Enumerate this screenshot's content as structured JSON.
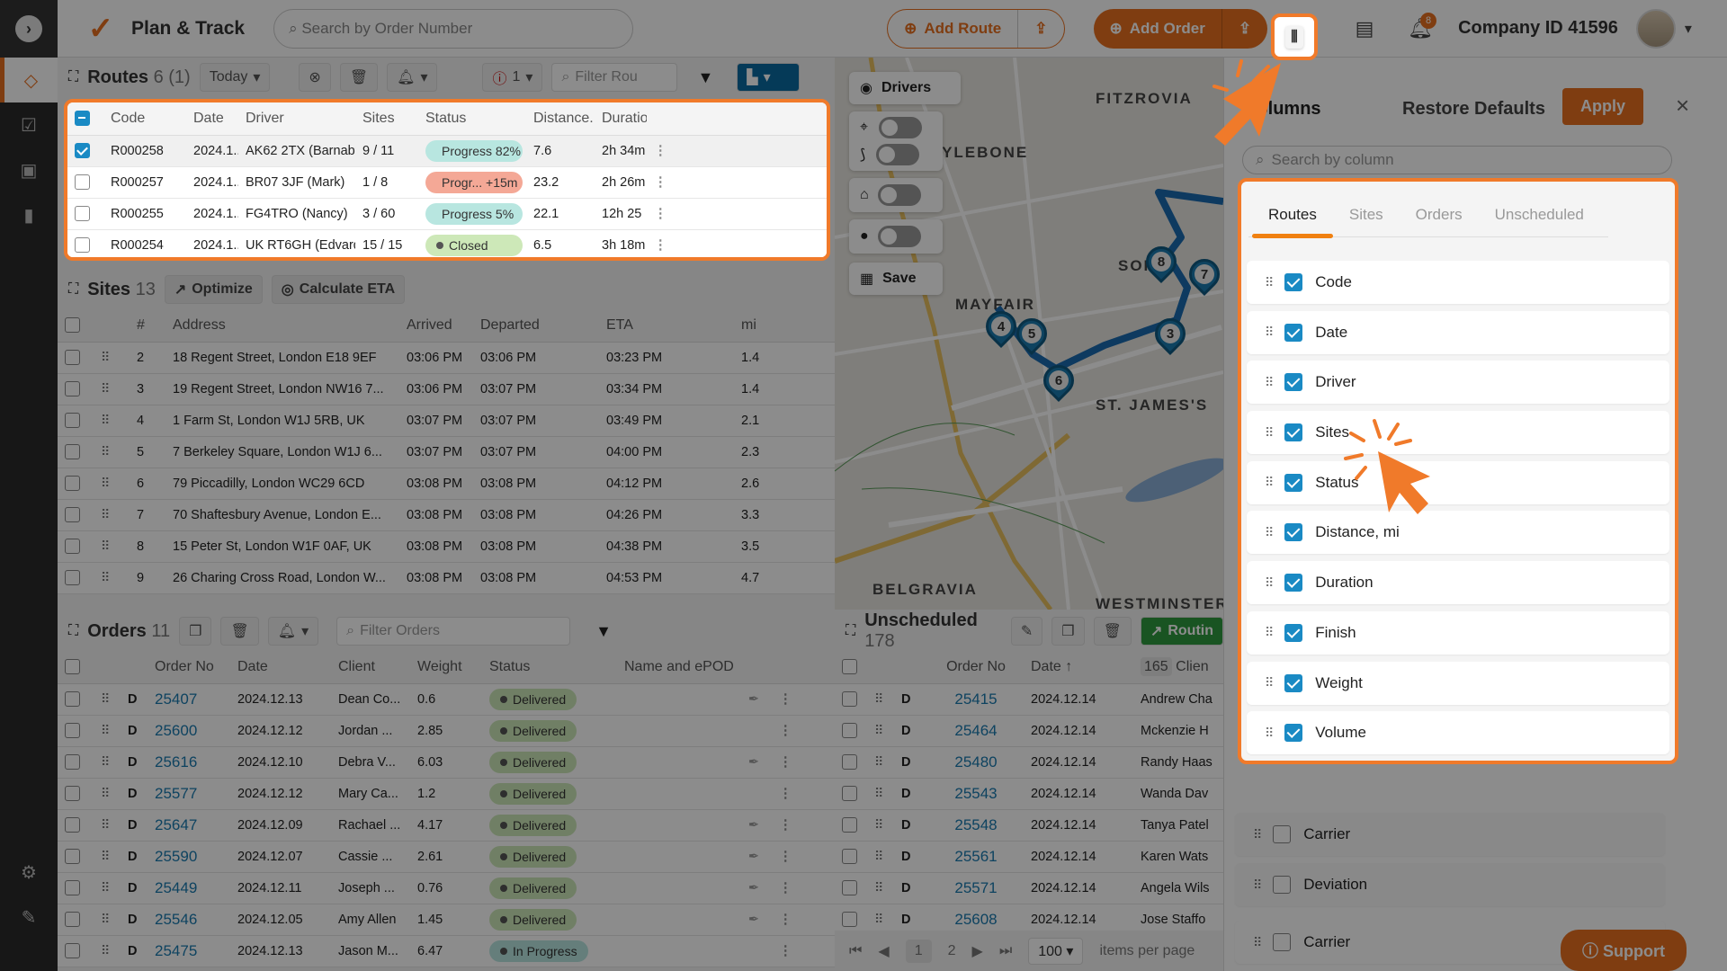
{
  "header": {
    "app_title": "Plan & Track",
    "search_placeholder": "Search by Order Number",
    "add_route_label": "Add Route",
    "add_order_label": "Add Order",
    "notification_count": "8",
    "company": "Company ID 41596"
  },
  "routes": {
    "title": "Routes",
    "count": "6 (1)",
    "date_filter": "Today",
    "alert_count": "1",
    "filter_placeholder": "Filter Rou",
    "columns": [
      "Code",
      "Date",
      "Driver",
      "Sites",
      "Status",
      "Distance...",
      "Duratio"
    ],
    "rows": [
      {
        "code": "R000258",
        "date": "2024.1...",
        "driver": "AK62 2TX (Barnaby)",
        "sites": "9 / 11",
        "status": "Progress 82%",
        "status_color": "#b8e6e0",
        "distance": "7.6",
        "duration": "2h 34m",
        "checked": true
      },
      {
        "code": "R000257",
        "date": "2024.1...",
        "driver": "BR07 3JF (Mark)",
        "sites": "1 / 8",
        "status": "Progr...  +15m",
        "status_color": "#f4a896",
        "distance": "23.2",
        "duration": "2h 26m",
        "checked": false
      },
      {
        "code": "R000255",
        "date": "2024.1...",
        "driver": "FG4TRO (Nancy)",
        "sites": "3 / 60",
        "status": "Progress 5%",
        "status_color": "#b8e6e0",
        "distance": "22.1",
        "duration": "12h 25",
        "checked": false
      },
      {
        "code": "R000254",
        "date": "2024.1...",
        "driver": "UK RT6GH (Edvard)",
        "sites": "15 / 15",
        "status": "Closed",
        "status_color": "#cde8b8",
        "distance": "6.5",
        "duration": "3h 18m",
        "checked": false
      }
    ]
  },
  "sites": {
    "title": "Sites",
    "count": "13",
    "optimize_label": "Optimize",
    "calc_eta_label": "Calculate ETA",
    "columns": [
      "#",
      "Address",
      "Arrived",
      "Departed",
      "ETA",
      "mi"
    ],
    "rows": [
      {
        "num": "2",
        "address": "18 Regent Street, London E18 9EF",
        "arrived": "03:06 PM",
        "departed": "03:06 PM",
        "eta": "03:23 PM",
        "mi": "1.4"
      },
      {
        "num": "3",
        "address": "19 Regent Street, London NW16 7...",
        "arrived": "03:06 PM",
        "departed": "03:07 PM",
        "eta": "03:34 PM",
        "mi": "1.4"
      },
      {
        "num": "4",
        "address": "1 Farm St, London W1J 5RB, UK",
        "arrived": "03:07 PM",
        "departed": "03:07 PM",
        "eta": "03:49 PM",
        "mi": "2.1"
      },
      {
        "num": "5",
        "address": "7 Berkeley Square, London W1J 6...",
        "arrived": "03:07 PM",
        "departed": "03:07 PM",
        "eta": "04:00 PM",
        "mi": "2.3"
      },
      {
        "num": "6",
        "address": "79 Piccadilly, London WC29 6CD",
        "arrived": "03:08 PM",
        "departed": "03:08 PM",
        "eta": "04:12 PM",
        "mi": "2.6"
      },
      {
        "num": "7",
        "address": "70 Shaftesbury Avenue, London E...",
        "arrived": "03:08 PM",
        "departed": "03:08 PM",
        "eta": "04:26 PM",
        "mi": "3.3"
      },
      {
        "num": "8",
        "address": "15 Peter St, London W1F 0AF, UK",
        "arrived": "03:08 PM",
        "departed": "03:08 PM",
        "eta": "04:38 PM",
        "mi": "3.5"
      },
      {
        "num": "9",
        "address": "26 Charing Cross Road, London W...",
        "arrived": "03:08 PM",
        "departed": "03:08 PM",
        "eta": "04:53 PM",
        "mi": "4.7"
      }
    ]
  },
  "orders": {
    "title": "Orders",
    "count": "11",
    "filter_placeholder": "Filter Orders",
    "columns": [
      "Order No",
      "Date",
      "Client",
      "Weight",
      "Status",
      "Name and ePOD"
    ],
    "rows": [
      {
        "type": "D",
        "order": "25407",
        "date": "2024.12.13",
        "client": "Dean Co...",
        "weight": "0.6",
        "status": "Delivered",
        "epod": true
      },
      {
        "type": "D",
        "order": "25600",
        "date": "2024.12.12",
        "client": "Jordan ...",
        "weight": "2.85",
        "status": "Delivered",
        "epod": false
      },
      {
        "type": "D",
        "order": "25616",
        "date": "2024.12.10",
        "client": "Debra V...",
        "weight": "6.03",
        "status": "Delivered",
        "epod": true
      },
      {
        "type": "D",
        "order": "25577",
        "date": "2024.12.12",
        "client": "Mary Ca...",
        "weight": "1.2",
        "status": "Delivered",
        "epod": false
      },
      {
        "type": "D",
        "order": "25647",
        "date": "2024.12.09",
        "client": "Rachael ...",
        "weight": "4.17",
        "status": "Delivered",
        "epod": true
      },
      {
        "type": "D",
        "order": "25590",
        "date": "2024.12.07",
        "client": "Cassie ...",
        "weight": "2.61",
        "status": "Delivered",
        "epod": true
      },
      {
        "type": "D",
        "order": "25449",
        "date": "2024.12.11",
        "client": "Joseph ...",
        "weight": "0.76",
        "status": "Delivered",
        "epod": true
      },
      {
        "type": "D",
        "order": "25546",
        "date": "2024.12.05",
        "client": "Amy Allen",
        "weight": "1.45",
        "status": "Delivered",
        "epod": true
      },
      {
        "type": "D",
        "order": "25475",
        "date": "2024.12.13",
        "client": "Jason M...",
        "weight": "6.47",
        "status": "In Progress",
        "epod": false
      }
    ]
  },
  "unscheduled": {
    "title": "Unscheduled",
    "count": "178",
    "routing_label": "Routin",
    "columns": [
      "Order No",
      "Date ↑",
      "Clien"
    ],
    "client_badge": "165",
    "rows": [
      {
        "type": "D",
        "order": "25415",
        "date": "2024.12.14",
        "client": "Andrew Cha"
      },
      {
        "type": "D",
        "order": "25464",
        "date": "2024.12.14",
        "client": "Mckenzie H"
      },
      {
        "type": "D",
        "order": "25480",
        "date": "2024.12.14",
        "client": "Randy Haas"
      },
      {
        "type": "D",
        "order": "25543",
        "date": "2024.12.14",
        "client": "Wanda Dav"
      },
      {
        "type": "D",
        "order": "25548",
        "date": "2024.12.14",
        "client": "Tanya Patel"
      },
      {
        "type": "D",
        "order": "25561",
        "date": "2024.12.14",
        "client": "Karen Wats"
      },
      {
        "type": "D",
        "order": "25571",
        "date": "2024.12.14",
        "client": "Angela Wils"
      },
      {
        "type": "D",
        "order": "25608",
        "date": "2024.12.14",
        "client": "Jose Staffo"
      }
    ],
    "pagination": {
      "pages": [
        "1",
        "2"
      ],
      "current": "1",
      "per_page": "100",
      "per_page_label": "items per page"
    }
  },
  "map": {
    "drivers_label": "Drivers",
    "save_label": "Save",
    "labels": [
      "FITZROVIA",
      "MARYLEBONE",
      "SOHO",
      "MAYFAIR",
      "ST. JAMES'S",
      "BELGRAVIA",
      "WESTMINSTER"
    ],
    "pins": [
      "4",
      "5",
      "6",
      "8",
      "7",
      "3"
    ]
  },
  "column_panel": {
    "title": "Columns",
    "restore_label": "Restore Defaults",
    "apply_label": "Apply",
    "search_placeholder": "Search by column",
    "tabs": [
      "Routes",
      "Sites",
      "Orders",
      "Unscheduled"
    ],
    "active_tab": "Routes",
    "visible_columns": [
      "Code",
      "Date",
      "Driver",
      "Sites",
      "Status",
      "Distance, mi",
      "Duration",
      "Finish",
      "Weight",
      "Volume"
    ],
    "hidden_columns": [
      "Carrier",
      "Deviation"
    ],
    "support_label": "Support"
  }
}
